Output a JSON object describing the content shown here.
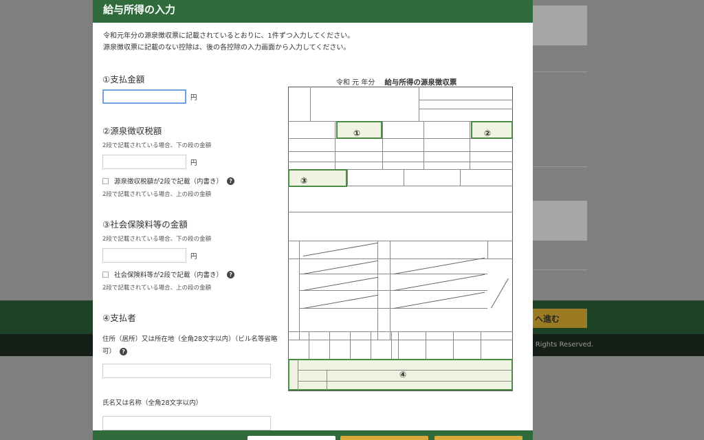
{
  "modal": {
    "title": "給与所得の入力",
    "intro_line1": "令和元年分の源泉徴収票に記載されているとおりに、1件ずつ入力してください。",
    "intro_line2": "源泉徴収票に記載のない控除は、後の各控除の入力画面から入力してください。"
  },
  "form": {
    "payment": {
      "title": "①支払金額",
      "value": "",
      "unit": "円"
    },
    "withholding": {
      "title": "②源泉徴収税額",
      "note_lower": "2段で記載されている場合、下の段の金額",
      "value": "",
      "unit": "円",
      "checkbox_label": "源泉徴収税額が2段で記載（内書き）",
      "note_upper": "2段で記載されている場合、上の段の金額"
    },
    "social_insurance": {
      "title": "③社会保険料等の金額",
      "note_lower": "2段で記載されている場合、下の段の金額",
      "value": "",
      "unit": "円",
      "checkbox_label": "社会保険料等が2段で記載（内書き）",
      "note_upper": "2段で記載されている場合、上の段の金額"
    },
    "payer": {
      "title": "④支払者",
      "address_label": "住所（居所）又は所在地（全角28文字以内）（ビル名等省略可）",
      "address_value": "",
      "name_label": "氏名又は名称（全角28文字以内）",
      "name_value": ""
    },
    "help_icon_glyph": "?"
  },
  "figure": {
    "era_label": "令和 元 年分",
    "title": "給与所得の源泉徴収票",
    "markers": [
      "①",
      "②",
      "③",
      "④"
    ]
  },
  "background": {
    "next_button_label": "へ進む",
    "copyright": "ll Rights Reserved."
  },
  "colors": {
    "header_green": "#2f6b3b",
    "highlight_green": "#4b8a45",
    "focus_blue": "#6fa0e0"
  }
}
